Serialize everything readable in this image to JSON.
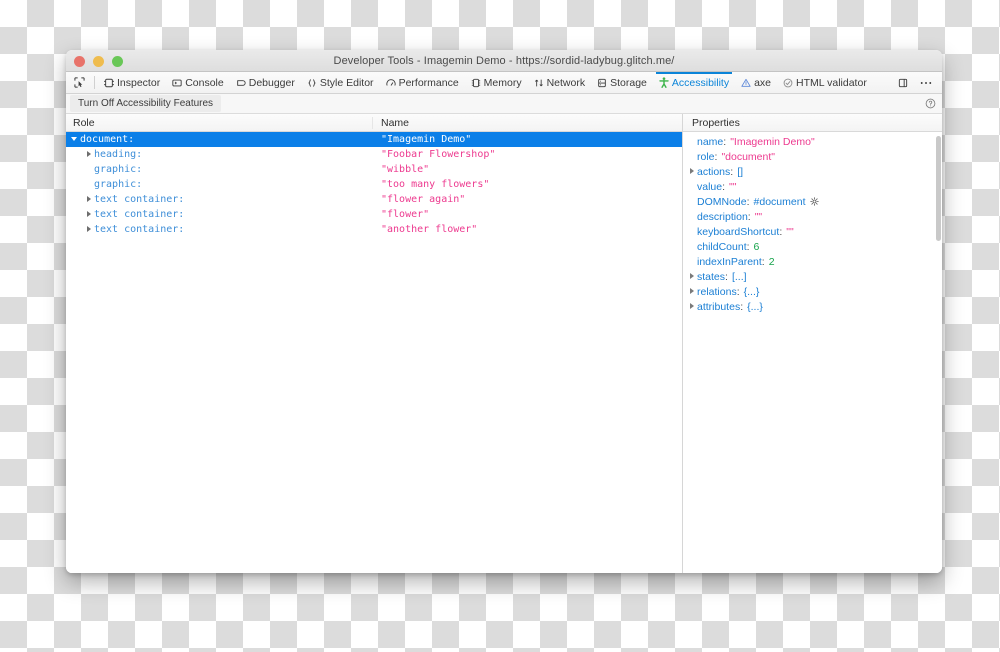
{
  "window": {
    "title": "Developer Tools - Imagemin Demo - https://sordid-ladybug.glitch.me/",
    "controls": [
      {
        "name": "close",
        "color": "#e8736a"
      },
      {
        "name": "minimize",
        "color": "#efbc4e"
      },
      {
        "name": "maximize",
        "color": "#69c757"
      }
    ]
  },
  "toolbar": {
    "picker_icon": "element-picker-icon",
    "tabs": [
      {
        "label": "Inspector",
        "icon": "inspector-icon",
        "active": false
      },
      {
        "label": "Console",
        "icon": "console-icon",
        "active": false
      },
      {
        "label": "Debugger",
        "icon": "debugger-icon",
        "active": false
      },
      {
        "label": "Style Editor",
        "icon": "style-editor-icon",
        "active": false
      },
      {
        "label": "Performance",
        "icon": "performance-icon",
        "active": false
      },
      {
        "label": "Memory",
        "icon": "memory-icon",
        "active": false
      },
      {
        "label": "Network",
        "icon": "network-icon",
        "active": false
      },
      {
        "label": "Storage",
        "icon": "storage-icon",
        "active": false
      },
      {
        "label": "Accessibility",
        "icon": "accessibility-person-icon",
        "active": true
      },
      {
        "label": "axe",
        "icon": "axe-icon",
        "active": false
      },
      {
        "label": "HTML validator",
        "icon": "html-validator-icon",
        "active": false
      }
    ],
    "dock_icon": "dock-panel-icon",
    "overflow_icon": "ellipsis-icon",
    "active_color": "#0b84d8",
    "accessibility_icon_color": "#3cb44a"
  },
  "subtoolbar": {
    "turn_off_button": "Turn Off Accessibility Features",
    "help_icon": "help-circle-icon"
  },
  "tree": {
    "columns": {
      "role": "Role",
      "name": "Name"
    },
    "selected_index": 0,
    "selection_color": "#0b7fe8",
    "rows": [
      {
        "role": "document:",
        "name": "\"Imagemin Demo\"",
        "indent": 0,
        "twisty": "open",
        "selected": true
      },
      {
        "role": "heading:",
        "name": "\"Foobar Flowershop\"",
        "indent": 1,
        "twisty": "closed",
        "selected": false
      },
      {
        "role": "graphic:",
        "name": "\"wibble\"",
        "indent": 1,
        "twisty": "none",
        "selected": false
      },
      {
        "role": "graphic:",
        "name": "\"too many flowers\"",
        "indent": 1,
        "twisty": "none",
        "selected": false
      },
      {
        "role": "text container:",
        "name": "\"flower again\"",
        "indent": 1,
        "twisty": "closed",
        "selected": false
      },
      {
        "role": "text container:",
        "name": "\"flower\"",
        "indent": 1,
        "twisty": "closed",
        "selected": false
      },
      {
        "role": "text container:",
        "name": "\"another flower\"",
        "indent": 1,
        "twisty": "closed",
        "selected": false
      }
    ]
  },
  "properties": {
    "header": "Properties",
    "rows": [
      {
        "key": "name",
        "value": "\"Imagemin Demo\"",
        "kind": "string",
        "twisty": "none",
        "gear": false
      },
      {
        "key": "role",
        "value": "\"document\"",
        "kind": "string",
        "twisty": "none",
        "gear": false
      },
      {
        "key": "actions",
        "value": "[]",
        "kind": "object",
        "twisty": "closed",
        "gear": false
      },
      {
        "key": "value",
        "value": "\"\"",
        "kind": "string",
        "twisty": "none",
        "gear": false
      },
      {
        "key": "DOMNode",
        "value": "#document",
        "kind": "node",
        "twisty": "none",
        "gear": true
      },
      {
        "key": "description",
        "value": "\"\"",
        "kind": "string",
        "twisty": "none",
        "gear": false
      },
      {
        "key": "keyboardShortcut",
        "value": "\"\"",
        "kind": "string",
        "twisty": "none",
        "gear": false
      },
      {
        "key": "childCount",
        "value": "6",
        "kind": "number",
        "twisty": "none",
        "gear": false
      },
      {
        "key": "indexInParent",
        "value": "2",
        "kind": "number",
        "twisty": "none",
        "gear": false
      },
      {
        "key": "states",
        "value": "[...]",
        "kind": "object",
        "twisty": "closed",
        "gear": false
      },
      {
        "key": "relations",
        "value": "{...}",
        "kind": "object",
        "twisty": "closed",
        "gear": false
      },
      {
        "key": "attributes",
        "value": "{...}",
        "kind": "object",
        "twisty": "closed",
        "gear": false
      }
    ],
    "colors": {
      "key": "#1b7fd4",
      "string": "#ed3a8f",
      "number": "#15a34a",
      "object": "#1b7fd4"
    }
  }
}
